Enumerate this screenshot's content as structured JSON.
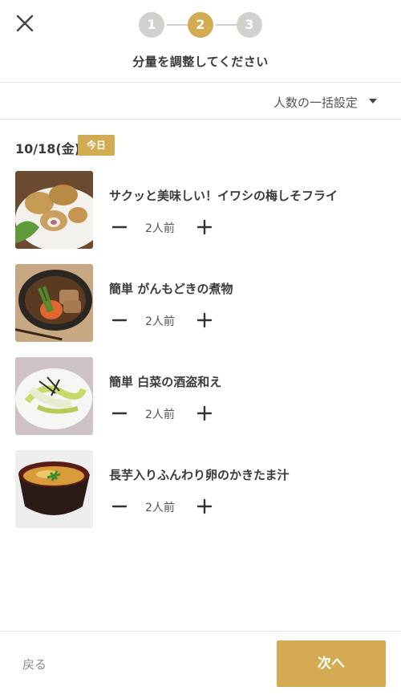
{
  "header": {
    "title": "分量を調整してください",
    "steps": [
      "1",
      "2",
      "3"
    ],
    "active_step": 2
  },
  "bulk_setting": {
    "label": "人数の一括設定"
  },
  "date_section": {
    "date": "10/18(金)",
    "badge": "今日"
  },
  "recipes": [
    {
      "title": "サクッと美味しい！イワシの梅しそフライ",
      "servings": "2人前"
    },
    {
      "title": "簡単 がんもどきの煮物",
      "servings": "2人前"
    },
    {
      "title": "簡単 白菜の酒盗和え",
      "servings": "2人前"
    },
    {
      "title": "長芋入りふんわり卵のかきたま汁",
      "servings": "2人前"
    }
  ],
  "footer": {
    "back_label": "戻る",
    "next_label": "次へ"
  },
  "colors": {
    "accent": "#d3ab52",
    "step_inactive": "#d3d1cd",
    "divider": "#e2e2e2",
    "text": "#3a3a3a"
  },
  "icons": {
    "close": "close-icon",
    "minus": "minus-icon",
    "plus": "plus-icon",
    "caret": "caret-down-icon"
  }
}
